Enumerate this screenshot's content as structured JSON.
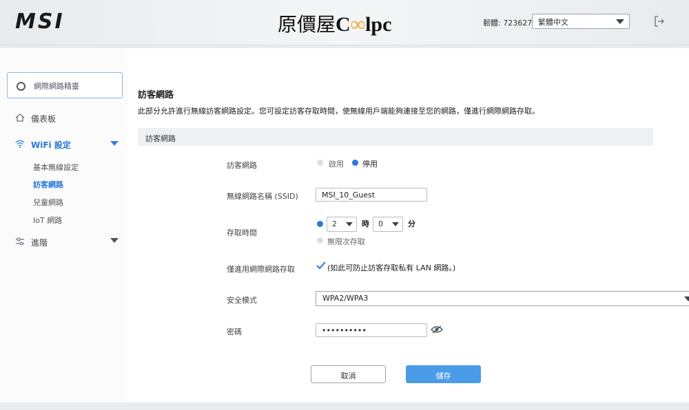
{
  "header": {
    "msi_logo": "MSI",
    "brand_text": "原價屋",
    "brand_cool_a": "C",
    "brand_cool_inf": "∞",
    "brand_cool_b": "lpc",
    "model_id": "韌體: 723627",
    "language": "繁體中文"
  },
  "sidebar": {
    "wizard": "網際網路精靈",
    "dashboard": "儀表板",
    "wifi_settings": "WiFi 設定",
    "sub_items": [
      "基本無線設定",
      "訪客網路",
      "兒童網路",
      "IoT 網路"
    ],
    "advanced": "進階"
  },
  "main": {
    "title": "訪客網路",
    "description": "此部分允許進行無線訪客網路設定。您可設定訪客存取時間，使無線用戶端能夠連接至您的網路，僅進行網際網路存取。",
    "section": "訪客網路",
    "guest_label": "訪客網路",
    "enable_label": "啟用",
    "disable_label": "停用",
    "ssid_label": "無線網路名稱 (SSID)",
    "ssid_value": "MSI_10_Guest",
    "access_time_label": "存取時間",
    "hours_value": "2",
    "hours_unit": "時",
    "minutes_value": "0",
    "minutes_unit": "分",
    "unlimited_label": "無限次存取",
    "internet_only_label": "僅進用網際網路存取",
    "internet_only_note": "(如此可防止訪客存取私有 LAN 網路。)",
    "security_label": "安全模式",
    "security_value": "WPA2/WPA3",
    "password_label": "密碼",
    "password_value": "••••••••••",
    "cancel": "取消",
    "save": "儲存"
  },
  "colors": {
    "accent": "#2a7ad6",
    "save_button": "#4a9be8",
    "brand_infinity": "#f5a623"
  }
}
